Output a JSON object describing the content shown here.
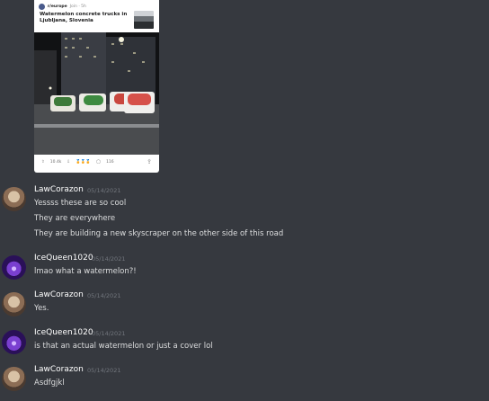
{
  "embed": {
    "subreddit": "r/europe",
    "meta": "Join · 5h",
    "title": "Watermelon concrete trucks in Ljubljana, Slovenia",
    "upvotes": "10.4k",
    "awards": "🏅🏅🏅",
    "comments": "116"
  },
  "messages": [
    {
      "user": "LawCorazon",
      "time": "05/14/2021",
      "avatar": "law",
      "lines": [
        "Yessss these are so cool",
        "They are everywhere",
        "They are building a new skyscraper on the other side of this road"
      ]
    },
    {
      "user": "IceQueen1020",
      "time": "05/14/2021",
      "avatar": "ice",
      "lines": [
        "lmao what a watermelon?!"
      ]
    },
    {
      "user": "LawCorazon",
      "time": "05/14/2021",
      "avatar": "law",
      "lines": [
        "Yes."
      ]
    },
    {
      "user": "IceQueen1020",
      "time": "05/14/2021",
      "avatar": "ice",
      "lines": [
        "is that an actual watermelon or just a cover lol"
      ]
    },
    {
      "user": "LawCorazon",
      "time": "05/14/2021",
      "avatar": "law",
      "lines": [
        "Asdfgjkl"
      ]
    }
  ]
}
